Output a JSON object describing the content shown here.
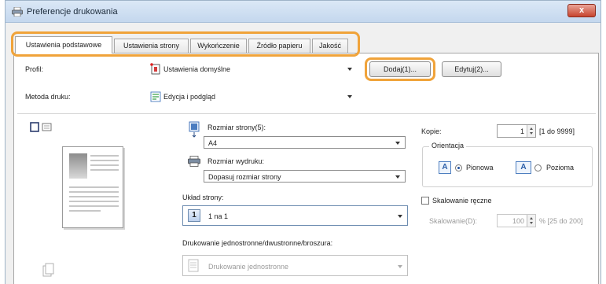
{
  "window": {
    "title": "Preferencje drukowania",
    "close_glyph": "x"
  },
  "tabs": [
    {
      "label": "Ustawienia podstawowe",
      "active": true
    },
    {
      "label": "Ustawienia strony",
      "active": false
    },
    {
      "label": "Wykończenie",
      "active": false
    },
    {
      "label": "Źródło papieru",
      "active": false
    },
    {
      "label": "Jakość",
      "active": false
    }
  ],
  "profile": {
    "label": "Profil:",
    "value": "Ustawienia domyślne",
    "add_button": "Dodaj(1)...",
    "edit_button": "Edytuj(2)..."
  },
  "print_method": {
    "label": "Metoda druku:",
    "value": "Edycja i podgląd"
  },
  "page_size": {
    "label": "Rozmiar strony(5):",
    "value": "A4"
  },
  "output_size": {
    "label": "Rozmiar wydruku:",
    "value": "Dopasuj rozmiar strony"
  },
  "layout": {
    "label": "Układ strony:",
    "value": "1 na 1",
    "icon_number": "1"
  },
  "duplex": {
    "label": "Drukowanie jednostronne/dwustronne/broszura:",
    "value": "Drukowanie jednostronne"
  },
  "copies": {
    "label": "Kopie:",
    "value": "1",
    "range": "[1 do 9999]"
  },
  "orientation": {
    "group_label": "Orientacja",
    "portrait_label": "Pionowa",
    "landscape_label": "Pozioma",
    "icon_letter": "A",
    "selected": "portrait"
  },
  "manual_scaling": {
    "checkbox_label": "Skalowanie ręczne",
    "checked": false,
    "scale_label": "Skalowanie(D):",
    "scale_value": "100",
    "scale_range": "% [25 do 200]"
  },
  "colors": {
    "highlight": "#f0a33a",
    "title_gradient_top": "#dbe8f6",
    "close_button": "#c7442e"
  },
  "icons": [
    "printer-icon",
    "close-icon",
    "profile-icon",
    "edit-preview-icon",
    "page-size-icon",
    "output-size-icon",
    "page-layout-icon",
    "duplex-icon",
    "preview-view-icon"
  ]
}
